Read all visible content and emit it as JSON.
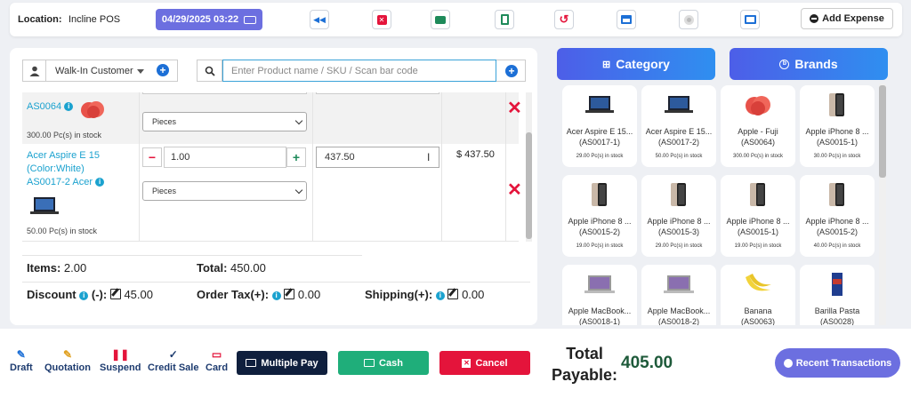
{
  "topbar": {
    "location_label": "Location:",
    "location_value": "Incline POS",
    "datetime": "04/29/2025 03:22",
    "add_expense": "Add Expense",
    "colors": {
      "accent": "#6c6fe0"
    }
  },
  "customer": {
    "selected": "Walk-In Customer"
  },
  "search": {
    "placeholder": "Enter Product name / SKU / Scan bar code"
  },
  "lines": [
    {
      "sku": "AS0064",
      "stock": "300.00 Pc(s) in stock",
      "unit": "Pieces"
    },
    {
      "name_line1": "Acer Aspire E 15",
      "name_line2": "(Color:White)",
      "name_line3": "AS0017-2 Acer",
      "stock": "50.00 Pc(s) in stock",
      "qty": "1.00",
      "price": "437.50",
      "subtotal": "$ 437.50",
      "unit": "Pieces"
    }
  ],
  "summary": {
    "items_label": "Items:",
    "items_value": "2.00",
    "total_label": "Total:",
    "total_value": "450.00",
    "discount_label": "Discount",
    "discount_sign": "(-):",
    "discount_value": "45.00",
    "tax_label": "Order Tax(+):",
    "tax_value": "0.00",
    "shipping_label": "Shipping(+):",
    "shipping_value": "0.00"
  },
  "tabs": {
    "category": "Category",
    "brands": "Brands"
  },
  "products": [
    {
      "name": "Acer Aspire E 15...",
      "code": "(AS0017-1)",
      "stock": "29.00 Pc(s) in stock",
      "kind": "laptop"
    },
    {
      "name": "Acer Aspire E 15...",
      "code": "(AS0017-2)",
      "stock": "50.00 Pc(s) in stock",
      "kind": "laptop"
    },
    {
      "name": "Apple - Fuji",
      "code": "(AS0064)",
      "stock": "300.00 Pc(s) in stock",
      "kind": "apple"
    },
    {
      "name": "Apple iPhone 8 ...",
      "code": "(AS0015-1)",
      "stock": "30.00 Pc(s) in stock",
      "kind": "phone"
    },
    {
      "name": "Apple iPhone 8 ...",
      "code": "(AS0015-2)",
      "stock": "19.00 Pc(s) in stock",
      "kind": "phone"
    },
    {
      "name": "Apple iPhone 8 ...",
      "code": "(AS0015-3)",
      "stock": "29.00 Pc(s) in stock",
      "kind": "phone"
    },
    {
      "name": "Apple iPhone 8 ...",
      "code": "(AS0015-1)",
      "stock": "19.00 Pc(s) in stock",
      "kind": "phone"
    },
    {
      "name": "Apple iPhone 8 ...",
      "code": "(AS0015-2)",
      "stock": "40.00 Pc(s) in stock",
      "kind": "phone"
    },
    {
      "name": "Apple MacBook...",
      "code": "(AS0018-1)",
      "stock": "",
      "kind": "macbook"
    },
    {
      "name": "Apple MacBook...",
      "code": "(AS0018-2)",
      "stock": "",
      "kind": "macbook"
    },
    {
      "name": "Banana",
      "code": "(AS0063)",
      "stock": "",
      "kind": "banana"
    },
    {
      "name": "Barilla Pasta",
      "code": "(AS0028)",
      "stock": "",
      "kind": "pasta"
    }
  ],
  "footer": {
    "draft": "Draft",
    "quotation": "Quotation",
    "suspend": "Suspend",
    "credit_sale": "Credit Sale",
    "card": "Card",
    "multiple_pay": "Multiple Pay",
    "cash": "Cash",
    "cancel": "Cancel",
    "total_payable_line1": "Total",
    "total_payable_line2": "Payable:",
    "total_payable_value": "405.00",
    "recent": "Recent Transactions"
  }
}
